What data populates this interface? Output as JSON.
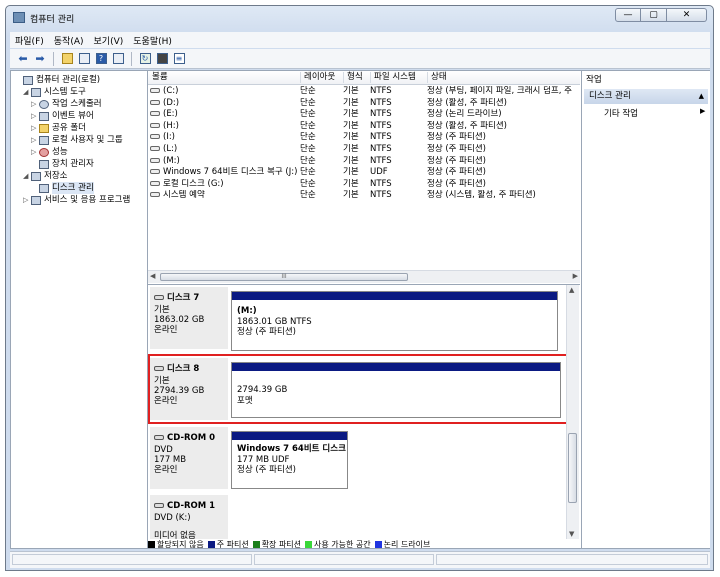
{
  "window": {
    "title": "컴퓨터 관리",
    "min": "—",
    "max": "▢",
    "close": "✕"
  },
  "menu": [
    "파일(F)",
    "동작(A)",
    "보기(V)",
    "도움말(H)"
  ],
  "tree": [
    {
      "label": "컴퓨터 관리(로컬)",
      "level": 0,
      "exp": ""
    },
    {
      "label": "시스템 도구",
      "level": 1,
      "exp": "◢"
    },
    {
      "label": "작업 스케줄러",
      "level": 2,
      "exp": "▷"
    },
    {
      "label": "이벤트 뷰어",
      "level": 2,
      "exp": "▷"
    },
    {
      "label": "공유 폴더",
      "level": 2,
      "exp": "▷"
    },
    {
      "label": "로컬 사용자 및 그룹",
      "level": 2,
      "exp": "▷"
    },
    {
      "label": "성능",
      "level": 2,
      "exp": "▷"
    },
    {
      "label": "장치 관리자",
      "level": 2,
      "exp": ""
    },
    {
      "label": "저장소",
      "level": 1,
      "exp": "◢"
    },
    {
      "label": "디스크 관리",
      "level": 2,
      "exp": "",
      "selected": true
    },
    {
      "label": "서비스 및 응용 프로그램",
      "level": 1,
      "exp": "▷"
    }
  ],
  "volume_table": {
    "columns": [
      "볼륨",
      "레이아웃",
      "형식",
      "파일 시스템",
      "상태"
    ],
    "rows": [
      [
        "(C:)",
        "단순",
        "기본",
        "NTFS",
        "정상 (부팅, 페이지 파일, 크래시 덤프, 주"
      ],
      [
        "(D:)",
        "단순",
        "기본",
        "NTFS",
        "정상 (활성, 주 파티션)"
      ],
      [
        "(E:)",
        "단순",
        "기본",
        "NTFS",
        "정상 (논리 드라이브)"
      ],
      [
        "(H:)",
        "단순",
        "기본",
        "NTFS",
        "정상 (활성, 주 파티션)"
      ],
      [
        "(I:)",
        "단순",
        "기본",
        "NTFS",
        "정상 (주 파티션)"
      ],
      [
        "(L:)",
        "단순",
        "기본",
        "NTFS",
        "정상 (주 파티션)"
      ],
      [
        "(M:)",
        "단순",
        "기본",
        "NTFS",
        "정상 (주 파티션)"
      ],
      [
        "Windows 7 64비트 디스크 복구 (J:)",
        "단순",
        "기본",
        "UDF",
        "정상 (주 파티션)"
      ],
      [
        "로컬 디스크 (G:)",
        "단순",
        "기본",
        "NTFS",
        "정상 (주 파티션)"
      ],
      [
        "시스템 예약",
        "단순",
        "기본",
        "NTFS",
        "정상 (시스템, 활성, 주 파티션)"
      ]
    ],
    "scroll_grip": "III"
  },
  "disks": [
    {
      "name": "디스크 7",
      "type": "기본",
      "size": "1863.02 GB",
      "status": "온라인",
      "part_name": "(M:)",
      "part_size": "1863.01 GB NTFS",
      "part_status": "정상 (주 파티션)"
    },
    {
      "name": "디스크 8",
      "type": "기본",
      "size": "2794.39 GB",
      "status": "온라인",
      "part_name": "",
      "part_size": "2794.39 GB",
      "part_status": "포맷"
    },
    {
      "name": "CD-ROM 0",
      "type": "DVD",
      "size": "177 MB",
      "status": "온라인",
      "part_name": "Windows 7 64비트 디스크",
      "part_size": "177 MB UDF",
      "part_status": "정상 (주 파티션)"
    },
    {
      "name": "CD-ROM 1",
      "type": "DVD (K:)",
      "size": "",
      "status": "미디어 없음"
    }
  ],
  "legend": [
    {
      "label": "할당되지 않음",
      "color": "#000000"
    },
    {
      "label": "주 파티션",
      "color": "#0b1a82"
    },
    {
      "label": "확장 파티션",
      "color": "#1b7f1b"
    },
    {
      "label": "사용 가능한 공간",
      "color": "#39d739"
    },
    {
      "label": "논리 드라이브",
      "color": "#1f34e0"
    }
  ],
  "actions": {
    "header": "작업",
    "section": "디스크 관리",
    "section_arrow": "▲",
    "item": "기타 작업",
    "item_arrow": "▶"
  }
}
